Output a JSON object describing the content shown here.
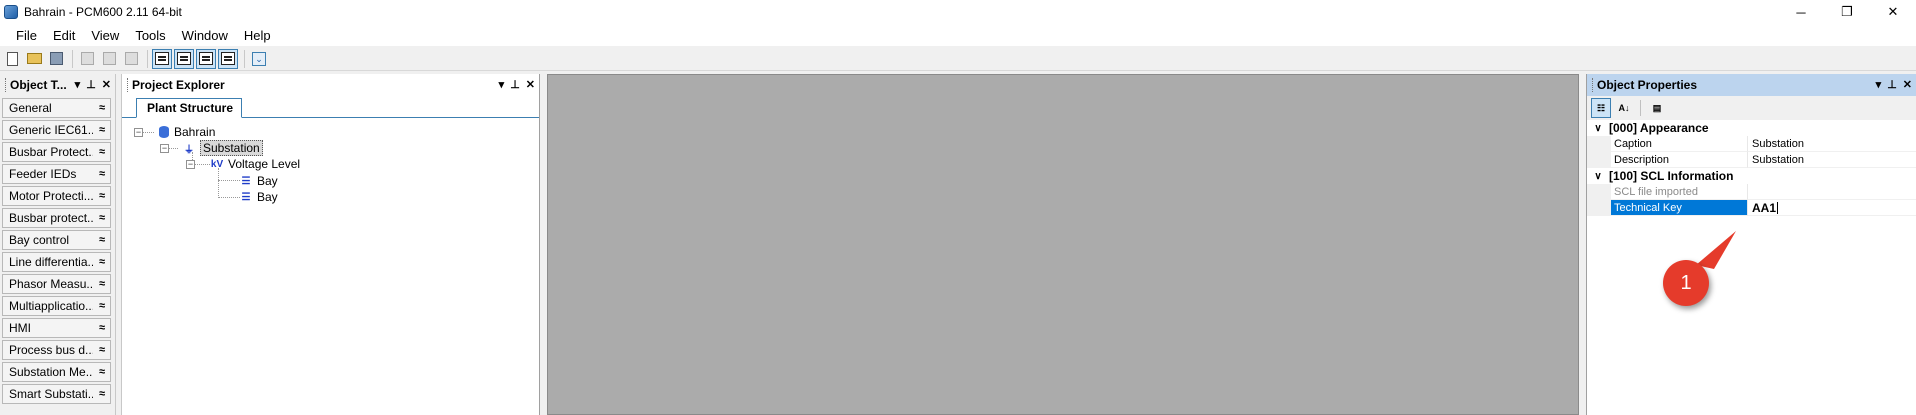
{
  "window": {
    "title": "Bahrain - PCM600 2.11 64-bit",
    "controls": {
      "minimize": "─",
      "restore": "❐",
      "close": "✕"
    }
  },
  "menu": [
    "File",
    "Edit",
    "View",
    "Tools",
    "Window",
    "Help"
  ],
  "object_types": {
    "title": "Object T...",
    "items": [
      "General",
      "Generic IEC61...",
      "Busbar Protect...",
      "Feeder IEDs",
      "Motor Protecti...",
      "Busbar protect...",
      "Bay control",
      "Line differentia...",
      "Phasor Measu...",
      "Multiapplicatio...",
      "HMI",
      "Process bus d...",
      "Substation Me...",
      "Smart Substati..."
    ],
    "chevron": "≈"
  },
  "project_explorer": {
    "title": "Project Explorer",
    "tab": "Plant Structure",
    "tree": {
      "root": "Bahrain",
      "substation": "Substation",
      "voltage_level": "Voltage Level",
      "bays": [
        "Bay",
        "Bay"
      ]
    },
    "icons": {
      "voltage": "kV",
      "bay": "☰"
    }
  },
  "object_properties": {
    "title": "Object Properties",
    "categories": [
      {
        "label": "[000] Appearance",
        "rows": [
          {
            "name": "Caption",
            "value": "Substation"
          },
          {
            "name": "Description",
            "value": "Substation"
          }
        ]
      },
      {
        "label": "[100] SCL Information",
        "rows": [
          {
            "name": "SCL file imported",
            "value": ""
          },
          {
            "name": "Technical Key",
            "value": "AA1"
          }
        ]
      }
    ]
  },
  "annotation": {
    "number": "1",
    "color": "#e53b2b"
  },
  "header_icons": {
    "dropdown": "▾",
    "pin": "⊥",
    "close": "✕"
  }
}
